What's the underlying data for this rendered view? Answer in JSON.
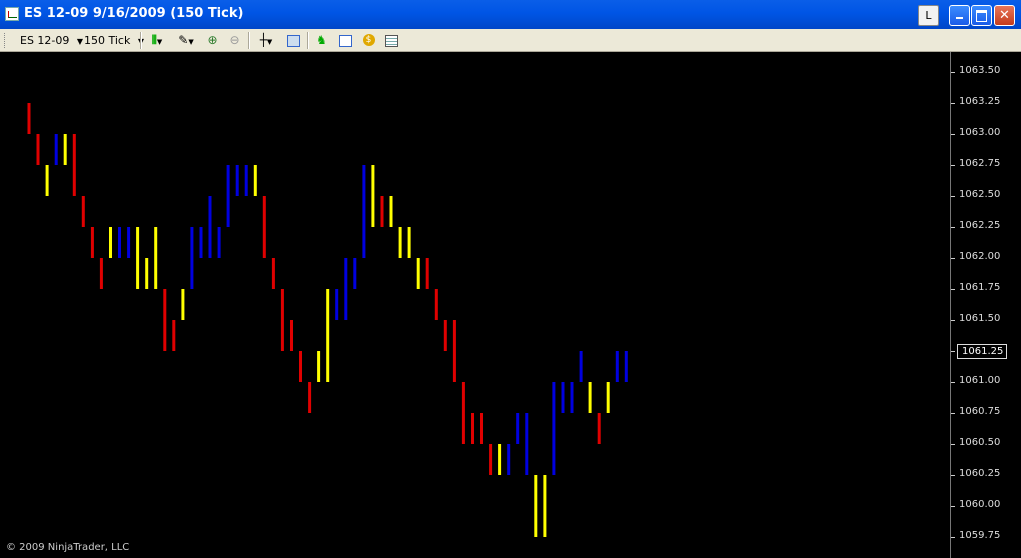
{
  "window": {
    "title": "ES 12-09  9/16/2009 (150 Tick)",
    "link_button": "L"
  },
  "toolbar": {
    "instrument": "ES 12-09",
    "interval": "150 Tick",
    "icons": [
      "chart-style-icon",
      "drawing-tool-icon",
      "zoom-in-icon",
      "zoom-out-icon",
      "crosshair-icon",
      "snapshot-icon",
      "strategy-icon",
      "indicator-icon",
      "currency-icon",
      "data-box-icon"
    ]
  },
  "copyright": "© 2009 NinjaTrader, LLC",
  "colors": {
    "up": "#0000e0",
    "down": "#e00000",
    "neutral": "#ffff00",
    "background": "#000000"
  },
  "chart_data": {
    "type": "bar",
    "title": "",
    "ylim": [
      1059.75,
      1063.5
    ],
    "yticks": [
      "1063.50",
      "1063.25",
      "1063.00",
      "1062.75",
      "1062.50",
      "1062.25",
      "1062.00",
      "1061.75",
      "1061.50",
      "1061.25",
      "1061.00",
      "1060.75",
      "1060.50",
      "1060.25",
      "1060.00",
      "1059.75"
    ],
    "last_price": "1061.25",
    "bars": [
      {
        "low": 1063.0,
        "high": 1063.25,
        "color": "red"
      },
      {
        "low": 1062.75,
        "high": 1063.0,
        "color": "red"
      },
      {
        "low": 1062.5,
        "high": 1062.75,
        "color": "yellow"
      },
      {
        "low": 1062.75,
        "high": 1063.0,
        "color": "blue"
      },
      {
        "low": 1062.75,
        "high": 1063.0,
        "color": "yellow"
      },
      {
        "low": 1062.5,
        "high": 1063.0,
        "color": "red"
      },
      {
        "low": 1062.25,
        "high": 1062.5,
        "color": "red"
      },
      {
        "low": 1062.0,
        "high": 1062.25,
        "color": "red"
      },
      {
        "low": 1061.75,
        "high": 1062.0,
        "color": "red"
      },
      {
        "low": 1062.0,
        "high": 1062.25,
        "color": "yellow"
      },
      {
        "low": 1062.0,
        "high": 1062.25,
        "color": "blue"
      },
      {
        "low": 1062.0,
        "high": 1062.25,
        "color": "blue"
      },
      {
        "low": 1061.75,
        "high": 1062.25,
        "color": "yellow"
      },
      {
        "low": 1061.75,
        "high": 1062.0,
        "color": "yellow"
      },
      {
        "low": 1061.75,
        "high": 1062.25,
        "color": "yellow"
      },
      {
        "low": 1061.25,
        "high": 1061.75,
        "color": "red"
      },
      {
        "low": 1061.25,
        "high": 1061.5,
        "color": "red"
      },
      {
        "low": 1061.5,
        "high": 1061.75,
        "color": "yellow"
      },
      {
        "low": 1061.75,
        "high": 1062.25,
        "color": "blue"
      },
      {
        "low": 1062.0,
        "high": 1062.25,
        "color": "blue"
      },
      {
        "low": 1062.0,
        "high": 1062.5,
        "color": "blue"
      },
      {
        "low": 1062.0,
        "high": 1062.25,
        "color": "blue"
      },
      {
        "low": 1062.25,
        "high": 1062.75,
        "color": "blue"
      },
      {
        "low": 1062.5,
        "high": 1062.75,
        "color": "blue"
      },
      {
        "low": 1062.5,
        "high": 1062.75,
        "color": "blue"
      },
      {
        "low": 1062.5,
        "high": 1062.75,
        "color": "yellow"
      },
      {
        "low": 1062.0,
        "high": 1062.5,
        "color": "red"
      },
      {
        "low": 1061.75,
        "high": 1062.0,
        "color": "red"
      },
      {
        "low": 1061.25,
        "high": 1061.75,
        "color": "red"
      },
      {
        "low": 1061.25,
        "high": 1061.5,
        "color": "red"
      },
      {
        "low": 1061.0,
        "high": 1061.25,
        "color": "red"
      },
      {
        "low": 1060.75,
        "high": 1061.0,
        "color": "red"
      },
      {
        "low": 1061.0,
        "high": 1061.25,
        "color": "yellow"
      },
      {
        "low": 1061.0,
        "high": 1061.75,
        "color": "yellow"
      },
      {
        "low": 1061.5,
        "high": 1061.75,
        "color": "blue"
      },
      {
        "low": 1061.5,
        "high": 1062.0,
        "color": "blue"
      },
      {
        "low": 1061.75,
        "high": 1062.0,
        "color": "blue"
      },
      {
        "low": 1062.0,
        "high": 1062.75,
        "color": "blue"
      },
      {
        "low": 1062.25,
        "high": 1062.75,
        "color": "yellow"
      },
      {
        "low": 1062.25,
        "high": 1062.5,
        "color": "red"
      },
      {
        "low": 1062.25,
        "high": 1062.5,
        "color": "yellow"
      },
      {
        "low": 1062.0,
        "high": 1062.25,
        "color": "yellow"
      },
      {
        "low": 1062.0,
        "high": 1062.25,
        "color": "yellow"
      },
      {
        "low": 1061.75,
        "high": 1062.0,
        "color": "yellow"
      },
      {
        "low": 1061.75,
        "high": 1062.0,
        "color": "red"
      },
      {
        "low": 1061.5,
        "high": 1061.75,
        "color": "red"
      },
      {
        "low": 1061.25,
        "high": 1061.5,
        "color": "red"
      },
      {
        "low": 1061.0,
        "high": 1061.5,
        "color": "red"
      },
      {
        "low": 1060.5,
        "high": 1061.0,
        "color": "red"
      },
      {
        "low": 1060.5,
        "high": 1060.75,
        "color": "red"
      },
      {
        "low": 1060.5,
        "high": 1060.75,
        "color": "red"
      },
      {
        "low": 1060.25,
        "high": 1060.5,
        "color": "red"
      },
      {
        "low": 1060.25,
        "high": 1060.5,
        "color": "yellow"
      },
      {
        "low": 1060.25,
        "high": 1060.5,
        "color": "blue"
      },
      {
        "low": 1060.5,
        "high": 1060.75,
        "color": "blue"
      },
      {
        "low": 1060.25,
        "high": 1060.75,
        "color": "blue"
      },
      {
        "low": 1059.75,
        "high": 1060.25,
        "color": "yellow"
      },
      {
        "low": 1059.75,
        "high": 1060.25,
        "color": "yellow"
      },
      {
        "low": 1060.25,
        "high": 1061.0,
        "color": "blue"
      },
      {
        "low": 1060.75,
        "high": 1061.0,
        "color": "blue"
      },
      {
        "low": 1060.75,
        "high": 1061.0,
        "color": "blue"
      },
      {
        "low": 1061.0,
        "high": 1061.25,
        "color": "blue"
      },
      {
        "low": 1060.75,
        "high": 1061.0,
        "color": "yellow"
      },
      {
        "low": 1060.5,
        "high": 1060.75,
        "color": "red"
      },
      {
        "low": 1060.75,
        "high": 1061.0,
        "color": "yellow"
      },
      {
        "low": 1061.0,
        "high": 1061.25,
        "color": "blue"
      },
      {
        "low": 1061.0,
        "high": 1061.25,
        "color": "blue"
      }
    ]
  }
}
